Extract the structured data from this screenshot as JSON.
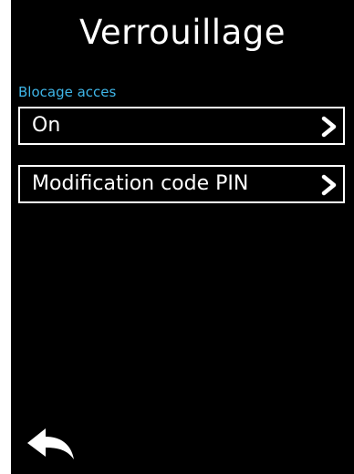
{
  "header": {
    "title": "Verrouillage"
  },
  "section": {
    "label": "Blocage acces"
  },
  "rows": [
    {
      "label": "On",
      "icon": "chevron-right-icon"
    },
    {
      "label": "Modification code PIN",
      "icon": "chevron-right-icon"
    }
  ],
  "footer": {
    "back_icon": "back-arrow-icon"
  },
  "colors": {
    "background": "#000000",
    "text": "#ffffff",
    "accent": "#3fb6e8"
  }
}
